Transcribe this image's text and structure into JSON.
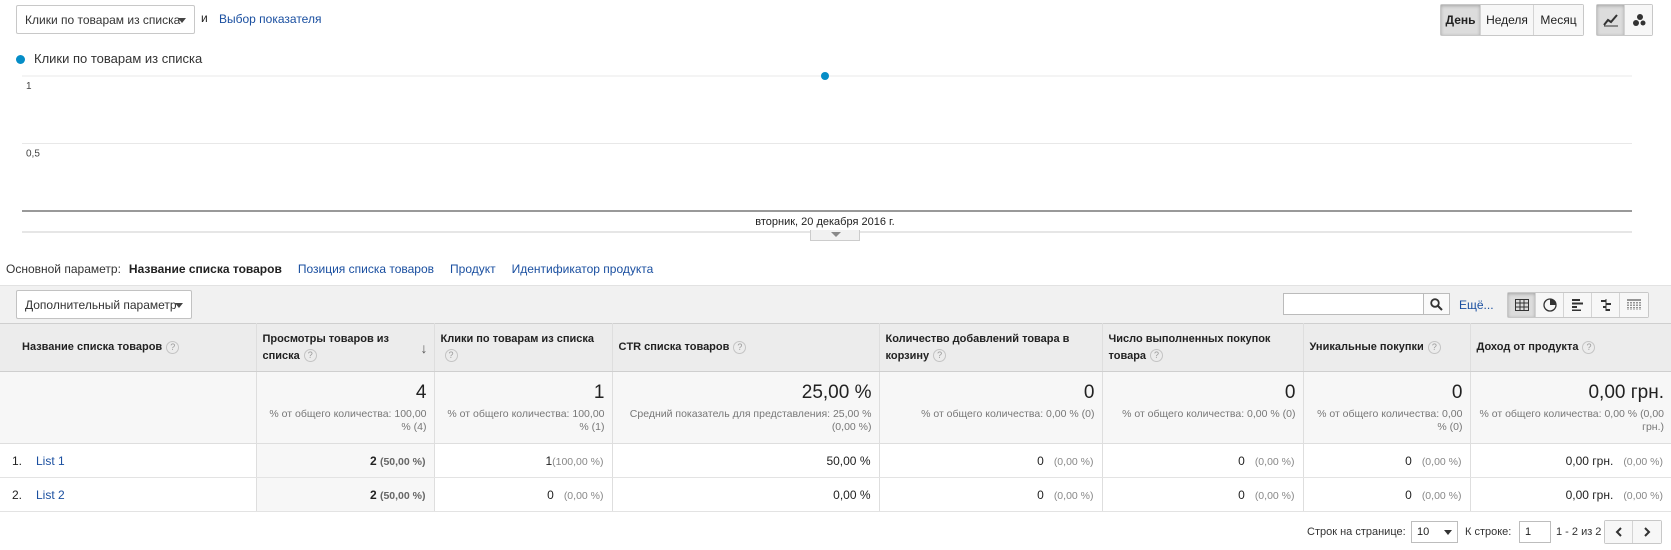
{
  "controls": {
    "metric_select": "Клики по товарам из списка",
    "and_label": "и",
    "metric_link": "Выбор показателя",
    "periods": [
      "День",
      "Неделя",
      "Месяц"
    ],
    "active_period": "День",
    "chart_modes": [
      "line-chart-icon",
      "motion-chart-icon"
    ]
  },
  "chart_data": {
    "type": "line",
    "series": [
      {
        "name": "Клики по товарам из списка",
        "color": "#058dc7",
        "values": [
          1
        ]
      }
    ],
    "x": [
      "вторник, 20 декабря 2016 г."
    ],
    "y_ticks": [
      "1",
      "0,5"
    ],
    "ylim": [
      0,
      1
    ],
    "grid": true,
    "legend": "top-left"
  },
  "dimensions": {
    "label": "Основной параметр:",
    "items": [
      "Название списка товаров",
      "Позиция списка товаров",
      "Продукт",
      "Идентификатор продукта"
    ],
    "active_index": 0
  },
  "toolbar": {
    "secondary_dimension": "Дополнительный параметр",
    "search_value": "",
    "more_label": "Ещё...",
    "view_icons": [
      "table-view-icon",
      "pie-view-icon",
      "bar-view-icon",
      "comparison-view-icon",
      "pivot-view-icon"
    ]
  },
  "table": {
    "headers": [
      "Название списка товаров",
      "Просмотры товаров из списка",
      "Клики по товарам из списка",
      "CTR списка товаров",
      "Количество добавлений товара в корзину",
      "Число выполненных покупок товара",
      "Уникальные покупки",
      "Доход от продукта"
    ],
    "totals": [
      {
        "value": "4",
        "sub": "% от общего количества: 100,00 % (4)"
      },
      {
        "value": "1",
        "sub": "% от общего количества: 100,00 % (1)"
      },
      {
        "value": "25,00 %",
        "sub": "Средний показатель для представления: 25,00 % (0,00 %)"
      },
      {
        "value": "0",
        "sub": "% от общего количества: 0,00 % (0)"
      },
      {
        "value": "0",
        "sub": "% от общего количества: 0,00 % (0)"
      },
      {
        "value": "0",
        "sub": "% от общего количества: 0,00 % (0)"
      },
      {
        "value": "0,00 грн.",
        "sub": "% от общего количества: 0,00 % (0,00 грн.)"
      }
    ],
    "rows": [
      {
        "rank": "1.",
        "name": "List 1",
        "views": "2",
        "views_pct": "(50,00 %)",
        "clicks": "1",
        "clicks_pct": "(100,00 %)",
        "ctr": "50,00 %",
        "adds": "0",
        "adds_pct": "(0,00 %)",
        "purchases": "0",
        "purchases_pct": "(0,00 %)",
        "unique": "0",
        "unique_pct": "(0,00 %)",
        "revenue": "0,00 грн.",
        "revenue_pct": "(0,00 %)"
      },
      {
        "rank": "2.",
        "name": "List 2",
        "views": "2",
        "views_pct": "(50,00 %)",
        "clicks": "0",
        "clicks_pct": "(0,00 %)",
        "ctr": "0,00 %",
        "adds": "0",
        "adds_pct": "(0,00 %)",
        "purchases": "0",
        "purchases_pct": "(0,00 %)",
        "unique": "0",
        "unique_pct": "(0,00 %)",
        "revenue": "0,00 грн.",
        "revenue_pct": "(0,00 %)"
      }
    ]
  },
  "pagination": {
    "rows_label": "Строк на странице:",
    "rows_value": "10",
    "goto_label": "К строке:",
    "goto_value": "1",
    "range": "1 - 2 из 2"
  }
}
